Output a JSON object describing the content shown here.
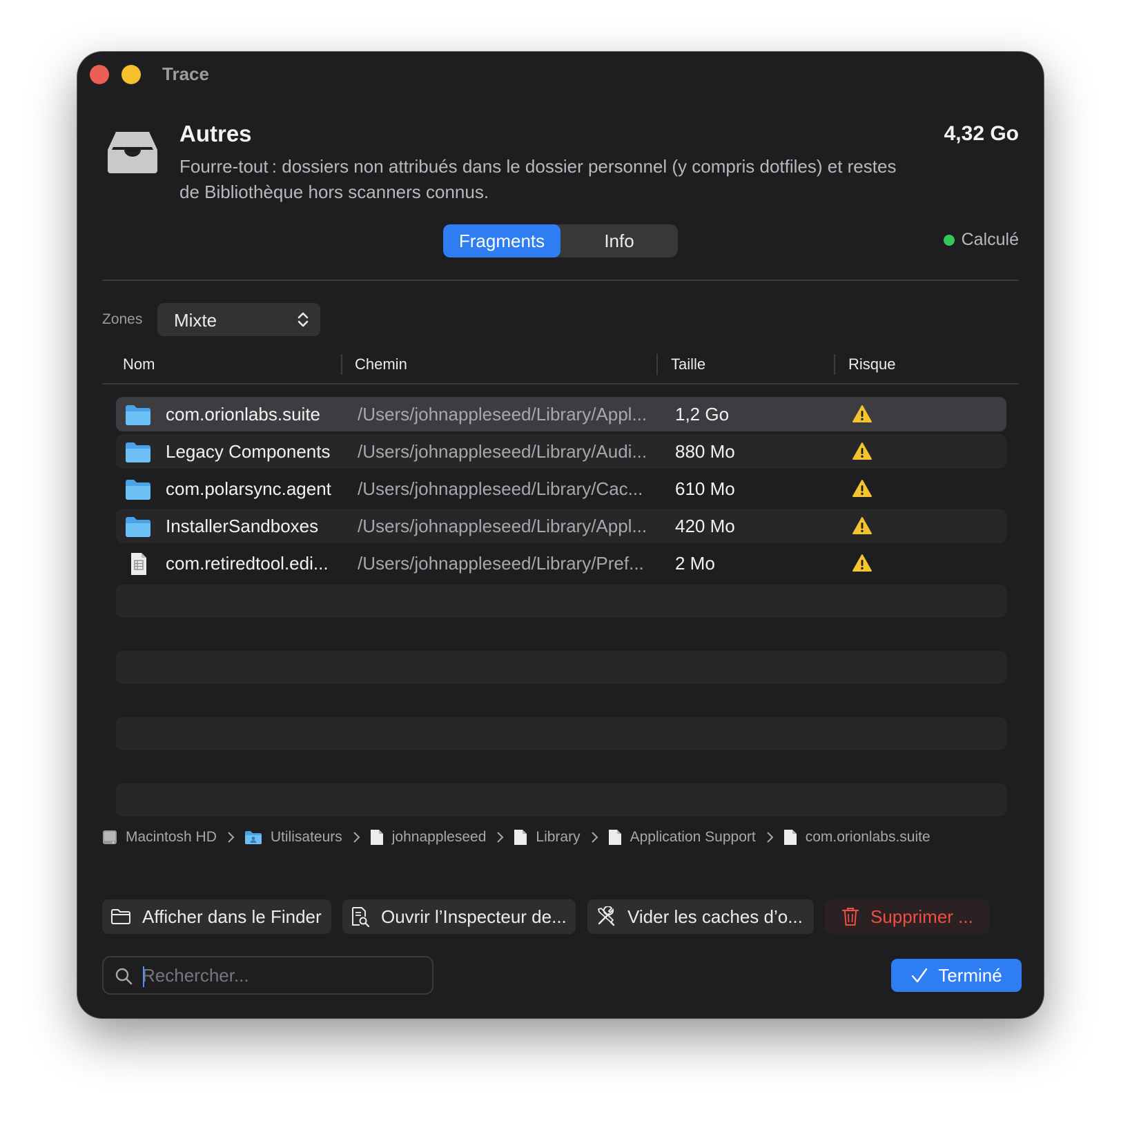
{
  "window": {
    "title": "Trace"
  },
  "category": {
    "title": "Autres",
    "description": "Fourre-tout : dossiers non attribués dans le dossier personnel (y compris dotfiles) et restes de Bibliothèque hors scanners connus.",
    "size": "4,32 Go",
    "status": "Calculé",
    "status_color": "#34c759",
    "icon": "tray-icon"
  },
  "tabs": [
    {
      "label": "Fragments",
      "active": true
    },
    {
      "label": "Info",
      "active": false
    }
  ],
  "zones": {
    "label": "Zones",
    "value": "Mixte"
  },
  "table": {
    "columns": [
      "Nom",
      "Chemin",
      "Taille",
      "Risque"
    ],
    "rows": [
      {
        "name": "com.orionlabs.suite",
        "path": "/Users/johnappleseed/Library/Appl...",
        "size": "1,2 Go",
        "kind": "folder",
        "risk": "warning-icon",
        "selected": true
      },
      {
        "name": "Legacy Components",
        "path": "/Users/johnappleseed/Library/Audi...",
        "size": "880 Mo",
        "kind": "folder",
        "risk": "warning-icon",
        "selected": false
      },
      {
        "name": "com.polarsync.agent",
        "path": "/Users/johnappleseed/Library/Cac...",
        "size": "610 Mo",
        "kind": "folder",
        "risk": "warning-icon",
        "selected": false
      },
      {
        "name": "InstallerSandboxes",
        "path": "/Users/johnappleseed/Library/Appl...",
        "size": "420 Mo",
        "kind": "folder",
        "risk": "warning-icon",
        "selected": false
      },
      {
        "name": "com.retiredtool.edi...",
        "path": "/Users/johnappleseed/Library/Pref...",
        "size": "2 Mo",
        "kind": "document",
        "risk": "warning-icon",
        "selected": false
      }
    ]
  },
  "breadcrumb": [
    {
      "label": "Macintosh HD",
      "icon": "disk-icon"
    },
    {
      "label": "Utilisateurs",
      "icon": "users-folder-icon"
    },
    {
      "label": "johnappleseed",
      "icon": "document-icon"
    },
    {
      "label": "Library",
      "icon": "document-icon"
    },
    {
      "label": "Application Support",
      "icon": "document-icon"
    },
    {
      "label": "com.orionlabs.suite",
      "icon": "document-icon"
    }
  ],
  "actions": {
    "finder": "Afficher dans le Finder",
    "inspector": "Ouvrir l’Inspecteur de...",
    "caches": "Vider les caches d’o...",
    "delete": "Supprimer ..."
  },
  "search": {
    "placeholder": "Rechercher..."
  },
  "done": {
    "label": "Terminé"
  },
  "colors": {
    "accent": "#2f7df2",
    "danger": "#ef4d46",
    "warning": "#f4c430",
    "folder": "#5eb4f0"
  }
}
